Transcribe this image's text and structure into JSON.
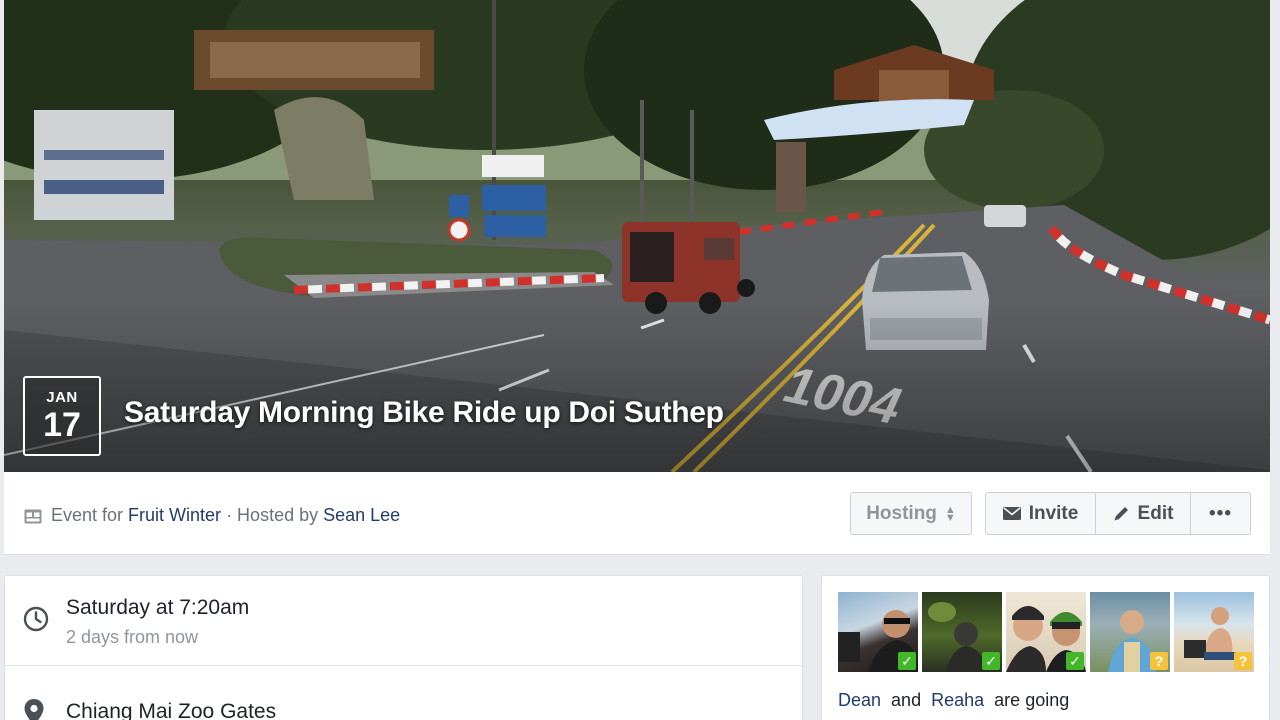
{
  "event": {
    "month": "JAN",
    "day": "17",
    "title": "Saturday Morning Bike Ride up Doi Suthep"
  },
  "host_line": {
    "prefix": "Event for ",
    "group": "Fruit Winter",
    "separator": " · Hosted by ",
    "host": "Sean Lee"
  },
  "actions": {
    "hosting": "Hosting",
    "invite": "Invite",
    "edit": "Edit",
    "more": "•••"
  },
  "details": {
    "time_main": "Saturday at 7:20am",
    "time_sub": "2 days from now",
    "location": "Chiang Mai Zoo Gates"
  },
  "attendees": {
    "avatars": [
      {
        "status": "going",
        "badge": "✓"
      },
      {
        "status": "going",
        "badge": "✓"
      },
      {
        "status": "going",
        "badge": "✓"
      },
      {
        "status": "maybe",
        "badge": "?"
      },
      {
        "status": "maybe",
        "badge": "?"
      }
    ],
    "name1": "Dean",
    "and": " and ",
    "name2": "Reaha",
    "suffix": " are going"
  },
  "cover_signs": {
    "road_number": "1004"
  },
  "colors": {
    "link": "#233b6b",
    "going_badge": "#42b72a",
    "maybe_badge": "#f5c33b",
    "muted_text": "#90949c"
  },
  "icons": [
    "calendar-icon",
    "sort-icon",
    "envelope-icon",
    "pencil-icon",
    "clock-icon",
    "location-pin-icon"
  ]
}
